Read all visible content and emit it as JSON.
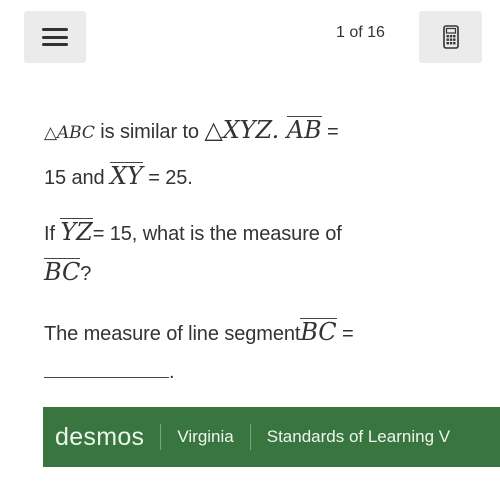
{
  "topbar": {
    "menu_icon": "hamburger-menu-icon",
    "page_counter": "1 of 16",
    "calculator_icon": "calculator-icon"
  },
  "question": {
    "line1": {
      "tri1": "△",
      "abc": "ABC",
      "text1": " is similar to ",
      "tri2": "△",
      "xyz": "XYZ",
      "dot": ". ",
      "ab": "AB",
      "eq": " ="
    },
    "line2": {
      "text1": "15 and ",
      "xy": "XY",
      "text2": " = 25."
    },
    "line3": {
      "text1": "If ",
      "yz": "YZ",
      "text2": "= 15, what is the measure of"
    },
    "line4": {
      "bc": "BC",
      "text": "?"
    },
    "line5": {
      "text1": "The measure of line segment",
      "bc": "BC",
      "eq": " ="
    },
    "line6": {
      "blank_value": "",
      "period": "."
    }
  },
  "footer": {
    "brand": "desmos",
    "items": [
      "Virginia",
      "Standards of Learning V"
    ],
    "color": "#38753f"
  }
}
